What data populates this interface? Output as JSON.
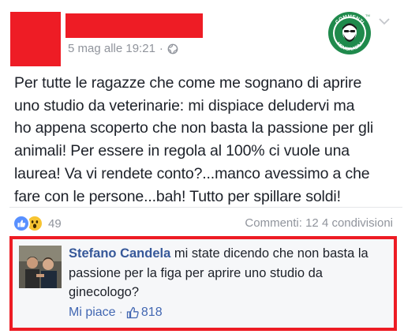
{
  "post": {
    "timestamp": "5 mag alle 19:21",
    "separator": "·",
    "text": "Per tutte le ragazze che come me sognano di aprire\nuno studio da veterinarie: mi dispiace deludervi ma\nho appena scoperto che non basta la passione per gli\nanimali! Per essere in regola al 100% ci vuole una\nlaurea! Va vi rendete conto?...manco avessimo a che\nfare con le persone...bah! Tutto per spillare soldi!",
    "reaction_count": "49",
    "stats": "Commenti: 12 4 condivisioni"
  },
  "logo": {
    "top_text": "COMMENTI",
    "bottom_text": "MEMORABILI",
    "tm": "TM"
  },
  "comment": {
    "author": "Stefano Candela",
    "text": "mi state dicendo che non basta la passione per la figa per aprire uno studio da ginecologo?",
    "like_label": "Mi piace",
    "separator": "·",
    "like_count": "818"
  },
  "icons": {
    "visibility": "globe-icon",
    "menu": "chevron-down-icon",
    "reaction_1": "like-reaction-icon",
    "reaction_2": "wow-reaction-icon",
    "comment_like": "thumbs-up-icon"
  },
  "colors": {
    "redaction": "#ee1c25",
    "link": "#365899",
    "action": "#4267b2",
    "muted": "#90949c",
    "logo_green": "#1f8a4c"
  }
}
